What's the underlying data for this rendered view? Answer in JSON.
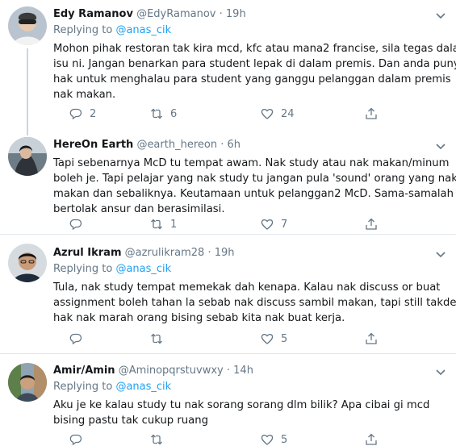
{
  "tweets": [
    {
      "name": "Edy Ramanov",
      "handle": "@EdyRamanov",
      "dot": "·",
      "time": "19h",
      "replying_prefix": "Replying to",
      "replying_to": "@anas_cik",
      "lines": [
        "Mohon pihak restoran tak kira mcd, kfc atau mana2 francise, sila tegas dalam",
        "isu ni. Jangan benarkan para student lepak di dalam premis. Dan anda punya",
        "hak untuk menghalau para student yang ganggu pelanggan dalam premis",
        "nak makan."
      ],
      "replies": "2",
      "retweets": "6",
      "likes": "24"
    },
    {
      "name": "HereOn Earth",
      "handle": "@earth_hereon",
      "dot": "·",
      "time": "6h",
      "replying_prefix": "",
      "replying_to": "",
      "lines": [
        "Tapi sebenarnya McD tu tempat awam. Nak study atau nak makan/minum",
        "boleh je. Tapi pelajar yang nak study tu jangan pula 'sound' orang yang nak",
        "makan dan sebaliknya.  Keutamaan untuk pelanggan2 McD.  Sama-samalah",
        "bertolak ansur dan berasimilasi."
      ],
      "replies": "",
      "retweets": "1",
      "likes": "7"
    },
    {
      "name": "Azrul Ikram",
      "handle": "@azrulikram28",
      "dot": "·",
      "time": "19h",
      "replying_prefix": "Replying to",
      "replying_to": "@anas_cik",
      "lines": [
        "Tula, nak study tempat memekak dah kenapa. Kalau nak discuss or buat",
        "assignment boleh tahan la sebab nak discuss sambil makan, tapi still takde",
        "hak nak marah orang bising sebab kita nak buat kerja."
      ],
      "replies": "",
      "retweets": "",
      "likes": "5"
    },
    {
      "name": "Amir/Amin",
      "handle": "@Aminopqrstuvwxy",
      "dot": "·",
      "time": "14h",
      "replying_prefix": "Replying to",
      "replying_to": "@anas_cik",
      "lines": [
        "Aku je ke kalau study tu nak sorang sorang dlm bilik? Apa cibai gi mcd",
        "bising pastu tak cukup ruang"
      ],
      "replies": "",
      "retweets": "",
      "likes": "5"
    }
  ],
  "icons": {
    "reply": "reply-icon",
    "retweet": "retweet-icon",
    "like": "like-icon",
    "share": "share-icon",
    "menu": "chevron-down-icon"
  },
  "colors": {
    "link": "#1da1f2",
    "secondary": "#657786",
    "border": "#e1e8ed",
    "thread_line": "#ccd6dd"
  }
}
